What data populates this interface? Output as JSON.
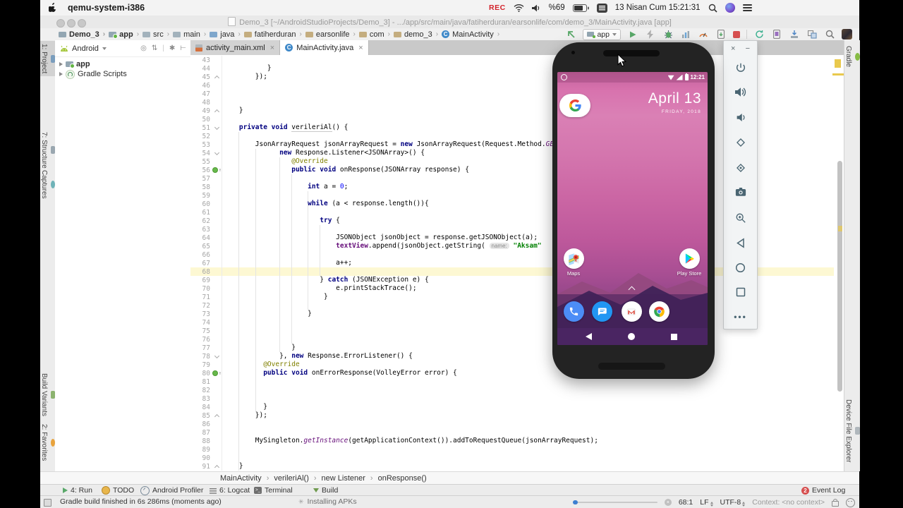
{
  "menubar": {
    "app_name": "qemu-system-i386",
    "rec": "REC",
    "battery": "%69",
    "clock": "13 Nisan Cum 15:21:31"
  },
  "window": {
    "title": "Demo_3 [~/AndroidStudioProjects/Demo_3] - .../app/src/main/java/fatiherduran/earsonlife/com/demo_3/MainActivity.java [app]"
  },
  "toolbar": {
    "breadcrumbs": [
      "Demo_3",
      "app",
      "src",
      "main",
      "java",
      "fatiherduran",
      "earsonlife",
      "com",
      "demo_3",
      "MainActivity"
    ],
    "run_config": "app"
  },
  "left_strip": [
    "1: Project",
    "7: Structure",
    "Captures",
    "Build Variants",
    "2: Favorites"
  ],
  "right_strip": [
    "Gradle",
    "Device File Explorer"
  ],
  "project": {
    "selector": "Android",
    "rows": [
      "app",
      "Gradle Scripts"
    ]
  },
  "tabs": {
    "xml": "activity_main.xml",
    "java": "MainActivity.java"
  },
  "code": {
    "lines": [
      {
        "n": 43,
        "t": []
      },
      {
        "n": 44,
        "t": [
          [
            "p",
            "           }"
          ]
        ]
      },
      {
        "n": 45,
        "fold": "up",
        "t": [
          [
            "p",
            "        });"
          ]
        ]
      },
      {
        "n": 46,
        "t": []
      },
      {
        "n": 47,
        "t": []
      },
      {
        "n": 48,
        "t": []
      },
      {
        "n": 49,
        "fold": "up",
        "t": [
          [
            "p",
            "    }"
          ]
        ]
      },
      {
        "n": 50,
        "t": []
      },
      {
        "n": 51,
        "fold": "down",
        "t": [
          [
            "p",
            "    "
          ],
          [
            "k",
            "private"
          ],
          [
            "p",
            " "
          ],
          [
            "k",
            "void"
          ],
          [
            "p",
            " "
          ],
          [
            "u",
            "verileriAl"
          ],
          [
            "p",
            "() {"
          ]
        ]
      },
      {
        "n": 52,
        "t": []
      },
      {
        "n": 53,
        "t": [
          [
            "p",
            "        JsonArrayRequest jsonArrayRequest = "
          ],
          [
            "k",
            "new"
          ],
          [
            "p",
            " JsonArrayRequest(Request.Method."
          ],
          [
            "i",
            "GE"
          ]
        ]
      },
      {
        "n": 54,
        "fold": "down",
        "t": [
          [
            "p",
            "              "
          ],
          [
            "k",
            "new"
          ],
          [
            "p",
            " Response.Listener<JSONArray>() {"
          ]
        ]
      },
      {
        "n": 55,
        "t": [
          [
            "p",
            "                 "
          ],
          [
            "a",
            "@Override"
          ]
        ]
      },
      {
        "n": 56,
        "ovr": true,
        "t": [
          [
            "p",
            "                 "
          ],
          [
            "k",
            "public"
          ],
          [
            "p",
            " "
          ],
          [
            "k",
            "void"
          ],
          [
            "p",
            " onResponse(JSONArray response) {"
          ]
        ]
      },
      {
        "n": 57,
        "t": []
      },
      {
        "n": 58,
        "t": [
          [
            "p",
            "                     "
          ],
          [
            "k",
            "int"
          ],
          [
            "p",
            " a = "
          ],
          [
            "n2",
            "0"
          ],
          [
            "p",
            ";"
          ]
        ]
      },
      {
        "n": 59,
        "t": []
      },
      {
        "n": 60,
        "t": [
          [
            "p",
            "                     "
          ],
          [
            "k",
            "while"
          ],
          [
            "p",
            " (a < response.length()){"
          ]
        ]
      },
      {
        "n": 61,
        "t": []
      },
      {
        "n": 62,
        "t": [
          [
            "p",
            "                        "
          ],
          [
            "k",
            "try"
          ],
          [
            "p",
            " {"
          ]
        ]
      },
      {
        "n": 63,
        "t": []
      },
      {
        "n": 64,
        "t": [
          [
            "p",
            "                            JSONObject jsonObject = response.getJSONObject(a);"
          ]
        ]
      },
      {
        "n": 65,
        "t": [
          [
            "p",
            "                            "
          ],
          [
            "f",
            "textView"
          ],
          [
            "p",
            ".append(jsonObject.getString( "
          ],
          [
            "h",
            "name:"
          ],
          [
            "p",
            " "
          ],
          [
            "s",
            "\"Aksam\""
          ]
        ]
      },
      {
        "n": 66,
        "t": []
      },
      {
        "n": 67,
        "t": [
          [
            "p",
            "                            a++;"
          ]
        ]
      },
      {
        "n": 68,
        "caret": true,
        "t": []
      },
      {
        "n": 69,
        "t": [
          [
            "p",
            "                        } "
          ],
          [
            "k",
            "catch"
          ],
          [
            "p",
            " (JSONException e) {"
          ]
        ]
      },
      {
        "n": 70,
        "t": [
          [
            "p",
            "                            e.printStackTrace();"
          ]
        ]
      },
      {
        "n": 71,
        "t": [
          [
            "p",
            "                         }"
          ]
        ]
      },
      {
        "n": 72,
        "t": []
      },
      {
        "n": 73,
        "t": [
          [
            "p",
            "                     }"
          ]
        ]
      },
      {
        "n": 74,
        "t": []
      },
      {
        "n": 75,
        "t": []
      },
      {
        "n": 76,
        "t": []
      },
      {
        "n": 77,
        "t": [
          [
            "p",
            "                 }"
          ]
        ]
      },
      {
        "n": 78,
        "fold": "down",
        "t": [
          [
            "p",
            "              }, "
          ],
          [
            "k",
            "new"
          ],
          [
            "p",
            " Response.ErrorListener() {"
          ]
        ]
      },
      {
        "n": 79,
        "t": [
          [
            "p",
            "          "
          ],
          [
            "a",
            "@Override"
          ]
        ]
      },
      {
        "n": 80,
        "ovr": true,
        "t": [
          [
            "p",
            "          "
          ],
          [
            "k",
            "public"
          ],
          [
            "p",
            " "
          ],
          [
            "k",
            "void"
          ],
          [
            "p",
            " onErrorResponse(VolleyError error) {"
          ]
        ]
      },
      {
        "n": 81,
        "t": []
      },
      {
        "n": 82,
        "t": []
      },
      {
        "n": 83,
        "t": []
      },
      {
        "n": 84,
        "t": [
          [
            "p",
            "          }"
          ]
        ]
      },
      {
        "n": 85,
        "fold": "up",
        "t": [
          [
            "p",
            "        });"
          ]
        ]
      },
      {
        "n": 86,
        "t": []
      },
      {
        "n": 87,
        "t": []
      },
      {
        "n": 88,
        "t": [
          [
            "p",
            "        MySingleton."
          ],
          [
            "i",
            "getInstance"
          ],
          [
            "p",
            "(getApplicationContext()).addToRequestQueue(jsonArrayRequest);"
          ]
        ]
      },
      {
        "n": 89,
        "t": []
      },
      {
        "n": 90,
        "t": []
      },
      {
        "n": 91,
        "fold": "up",
        "t": [
          [
            "p",
            "    }"
          ]
        ]
      }
    ]
  },
  "editor_breadcrumbs": [
    "MainActivity",
    "verileriAl()",
    "new Listener",
    "onResponse()"
  ],
  "toolwindows": {
    "run": "4: Run",
    "todo": "TODO",
    "profiler": "Android Profiler",
    "logcat": "6: Logcat",
    "terminal": "Terminal",
    "build": "Build",
    "event_log": "Event Log",
    "event_count": "2"
  },
  "status": {
    "message": "Gradle build finished in 6s 286ms (moments ago)",
    "installing": "Installing APKs",
    "caret_pos": "68:1",
    "line_sep": "LF",
    "encoding": "UTF-8",
    "context": "Context: <no context>"
  },
  "phone": {
    "time": "12:21",
    "date_big": "April 13",
    "date_small": "FRIDAY, 2018",
    "maps_label": "Maps",
    "play_label": "Play Store"
  },
  "colors": {
    "run_green": "#59a869",
    "stop_red": "#d64f4f",
    "caret_line": "#fdf8d3",
    "keyword_blue": "#000080",
    "string_green": "#008000",
    "wallpaper_pink": "#d873ae",
    "wallpaper_purple": "#6d3a78"
  }
}
